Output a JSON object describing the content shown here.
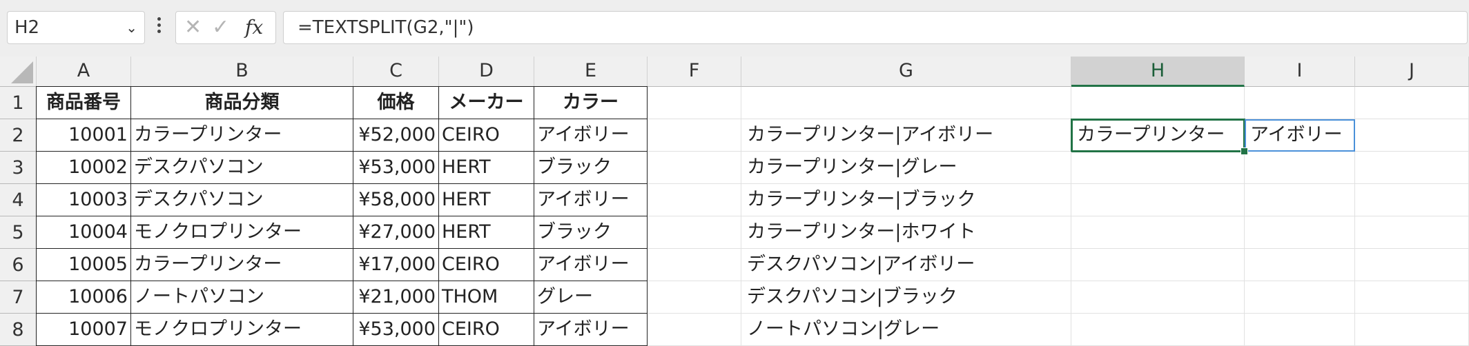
{
  "formula_bar": {
    "name_box": "H2",
    "formula": "=TEXTSPLIT(G2,\"|\")",
    "fx_label": "fx"
  },
  "columns": [
    "A",
    "B",
    "C",
    "D",
    "E",
    "F",
    "G",
    "H",
    "I",
    "J"
  ],
  "selected_column": "H",
  "row_numbers": [
    "1",
    "2",
    "3",
    "4",
    "5",
    "6",
    "7",
    "8"
  ],
  "table": {
    "headers": [
      "商品番号",
      "商品分類",
      "価格",
      "メーカー",
      "カラー"
    ],
    "rows": [
      [
        "10001",
        "カラープリンター",
        "¥52,000",
        "CEIRO",
        "アイボリー"
      ],
      [
        "10002",
        "デスクパソコン",
        "¥53,000",
        "HERT",
        "ブラック"
      ],
      [
        "10003",
        "デスクパソコン",
        "¥58,000",
        "HERT",
        "アイボリー"
      ],
      [
        "10004",
        "モノクロプリンター",
        "¥27,000",
        "HERT",
        "ブラック"
      ],
      [
        "10005",
        "カラープリンター",
        "¥17,000",
        "CEIRO",
        "アイボリー"
      ],
      [
        "10006",
        "ノートパソコン",
        "¥21,000",
        "THOM",
        "グレー"
      ],
      [
        "10007",
        "モノクロプリンター",
        "¥53,000",
        "CEIRO",
        "アイボリー"
      ]
    ]
  },
  "column_g": [
    "",
    "カラープリンター|アイボリー",
    "カラープリンター|グレー",
    "カラープリンター|ブラック",
    "カラープリンター|ホワイト",
    "デスクパソコン|アイボリー",
    "デスクパソコン|ブラック",
    "ノートパソコン|グレー"
  ],
  "spill": {
    "H2": "カラープリンター",
    "I2": "アイボリー"
  }
}
